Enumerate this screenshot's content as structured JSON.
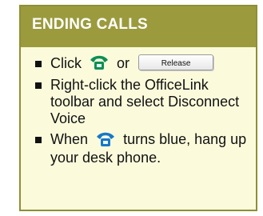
{
  "card": {
    "title": "ENDING CALLS",
    "items": [
      {
        "prefix": "Click",
        "icon": "green-phone-icon",
        "joiner": "or",
        "button_label": "Release"
      },
      {
        "text": "Right-click the OfficeLink toolbar and select Disconnect Voice"
      },
      {
        "prefix": "When",
        "icon": "blue-phone-icon",
        "suffix": "turns blue, hang up your desk phone."
      }
    ]
  },
  "colors": {
    "header": "#9b9b3e",
    "border": "#8e8f33",
    "body": "#fbfbdc",
    "phone_green": "#0c8f54",
    "phone_blue": "#1778c8"
  }
}
